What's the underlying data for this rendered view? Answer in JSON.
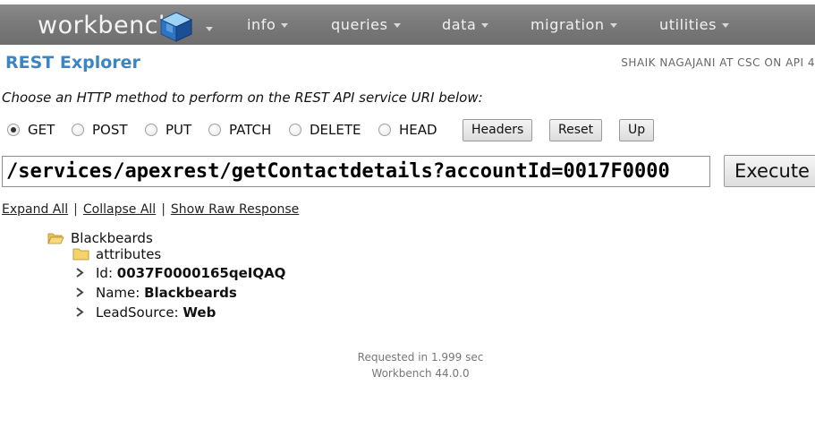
{
  "app": {
    "logo_text": "workbench",
    "menu": [
      {
        "label": "info"
      },
      {
        "label": "queries"
      },
      {
        "label": "data"
      },
      {
        "label": "migration"
      },
      {
        "label": "utilities"
      }
    ]
  },
  "header": {
    "title": "REST Explorer",
    "user_info": "SHAIK NAGAJANI AT CSC ON API 4"
  },
  "form": {
    "instruction": "Choose an HTTP method to perform on the REST API service URI below:",
    "methods": [
      {
        "label": "GET",
        "selected": true
      },
      {
        "label": "POST",
        "selected": false
      },
      {
        "label": "PUT",
        "selected": false
      },
      {
        "label": "PATCH",
        "selected": false
      },
      {
        "label": "DELETE",
        "selected": false
      },
      {
        "label": "HEAD",
        "selected": false
      }
    ],
    "buttons": {
      "headers": "Headers",
      "reset": "Reset",
      "up": "Up"
    },
    "uri_value": "/services/apexrest/getContactdetails?accountId=0017F0000",
    "execute_label": "Execute"
  },
  "links": {
    "expand_all": "Expand All",
    "collapse_all": "Collapse All",
    "show_raw": "Show Raw Response",
    "separator": "|"
  },
  "tree": {
    "root_label": "Blackbeards",
    "attributes_label": "attributes",
    "fields": [
      {
        "key": "Id:",
        "value": "0037F0000165qeIQAQ"
      },
      {
        "key": "Name:",
        "value": "Blackbeards"
      },
      {
        "key": "LeadSource:",
        "value": "Web"
      }
    ]
  },
  "footer": {
    "timing": "Requested in 1.999 sec",
    "version": "Workbench 44.0.0"
  },
  "colors": {
    "title_blue": "#3b85c6",
    "navbar_gray": "#7a7a7a"
  }
}
